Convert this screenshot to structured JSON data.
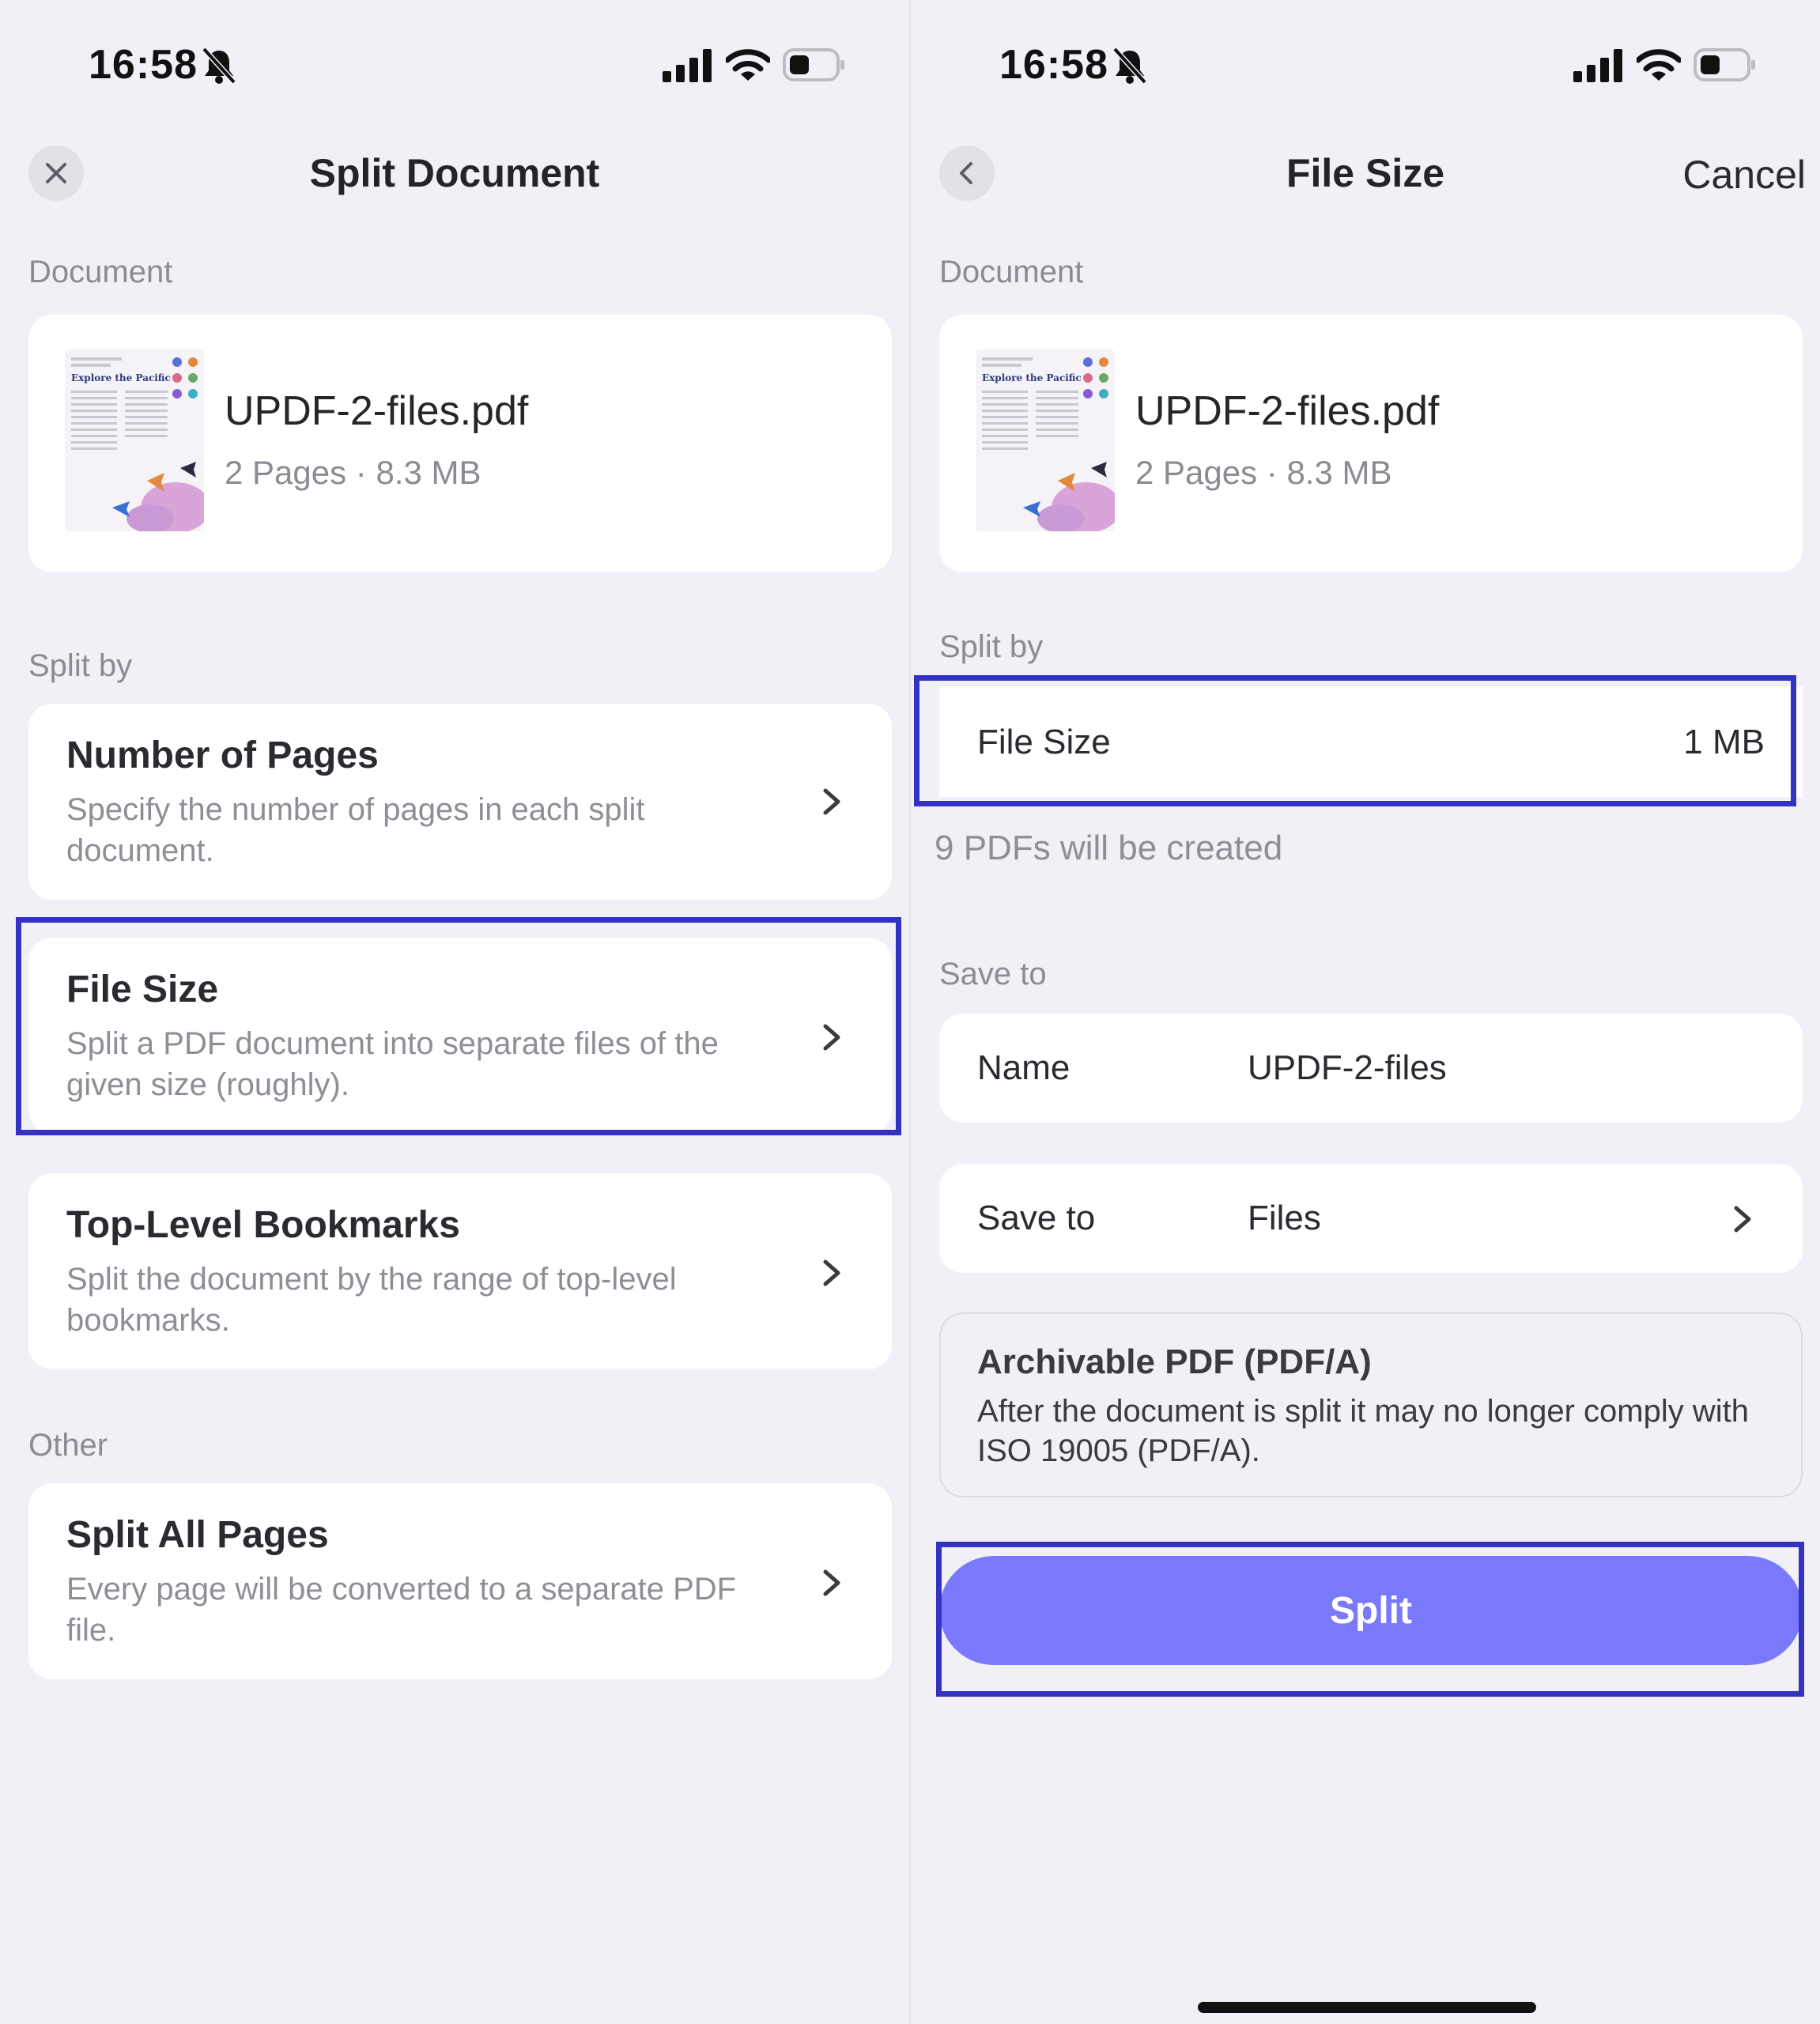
{
  "status_bar": {
    "time": "16:58"
  },
  "left_screen": {
    "title": "Split Document",
    "document_label": "Document",
    "document": {
      "name": "UPDF-2-files.pdf",
      "meta": "2 Pages · 8.3 MB",
      "thumb_title": "Explore the Pacific"
    },
    "split_by_label": "Split by",
    "options": [
      {
        "title": "Number of Pages",
        "description": "Specify the number of pages in each split document."
      },
      {
        "title": "File Size",
        "description": "Split a PDF document into separate files of the given size (roughly)."
      },
      {
        "title": "Top-Level Bookmarks",
        "description": "Split the document by the range of top-level bookmarks."
      }
    ],
    "other_label": "Other",
    "other_options": [
      {
        "title": "Split All Pages",
        "description": "Every page will be converted to a separate PDF file."
      }
    ]
  },
  "right_screen": {
    "title": "File Size",
    "cancel_label": "Cancel",
    "document_label": "Document",
    "document": {
      "name": "UPDF-2-files.pdf",
      "meta": "2 Pages · 8.3 MB",
      "thumb_title": "Explore the Pacific"
    },
    "split_by_label": "Split by",
    "file_size": {
      "label": "File Size",
      "value": "1 MB"
    },
    "created_note": "9 PDFs will be created",
    "save_to_label": "Save to",
    "name_row": {
      "label": "Name",
      "value": "UPDF-2-files"
    },
    "save_row": {
      "label": "Save to",
      "value": "Files"
    },
    "archivable": {
      "title": "Archivable PDF (PDF/A)",
      "description": "After the document is split it may no longer comply with ISO 19005 (PDF/A)."
    },
    "split_button_label": "Split"
  },
  "colors": {
    "accent": "#7a79fb",
    "highlight": "#3332c2",
    "background": "#f1f0f6"
  }
}
